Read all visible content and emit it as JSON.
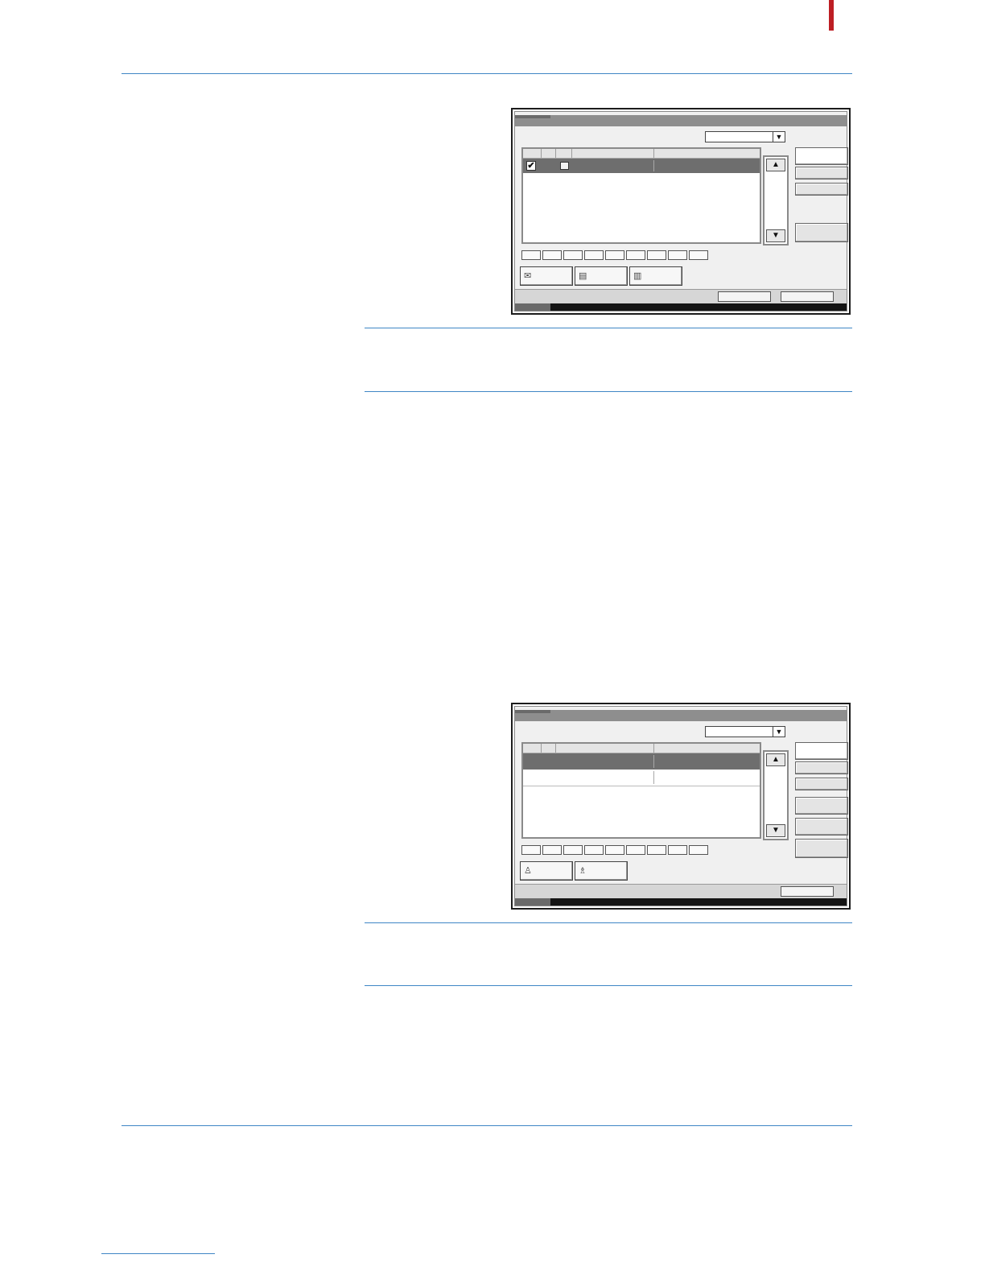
{
  "colors": {
    "rule": "#3f86c5",
    "edge_mark": "#bd1e24",
    "panel_frame": "#1c1c1c",
    "panel_bg": "#f0f0f0",
    "selected_row": "#6e6e6e"
  },
  "panel_1": {
    "dropdown_arrow": "▼",
    "scroll_up": "▲",
    "scroll_down": "▼",
    "row_checked": "✔",
    "row_icon": "document-icon",
    "tab_icons": [
      "envelope-icon",
      "folder-icon",
      "folders-icon"
    ],
    "index_button_count": 9
  },
  "panel_2": {
    "dropdown_arrow": "▼",
    "scroll_up": "▲",
    "scroll_down": "▼",
    "tab_icons": [
      "user-icon",
      "users-icon"
    ],
    "index_button_count": 9
  }
}
